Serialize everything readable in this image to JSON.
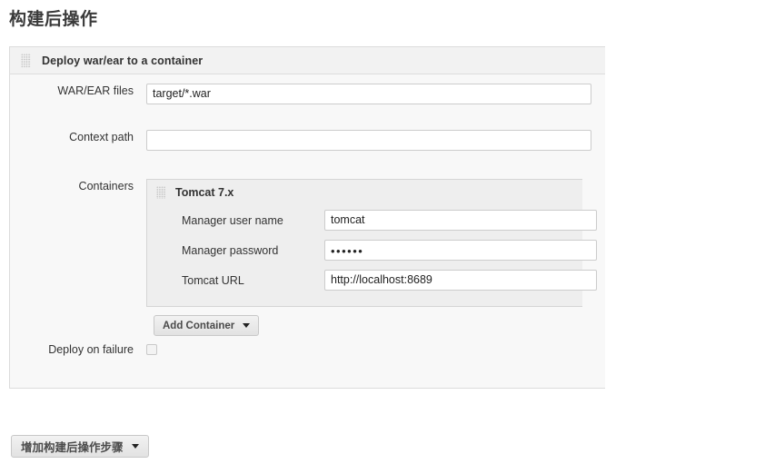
{
  "page": {
    "title": "构建后操作"
  },
  "post_build_block": {
    "title": "Deploy war/ear to a container",
    "grip_icon": "drag-grip-icon",
    "fields": {
      "war_ear_label": "WAR/EAR files",
      "war_ear_value": "target/*.war",
      "context_path_label": "Context path",
      "context_path_value": "",
      "containers_label": "Containers",
      "deploy_on_failure_label": "Deploy on failure",
      "deploy_on_failure_checked": false
    },
    "container": {
      "title": "Tomcat 7.x",
      "grip_icon": "drag-grip-icon",
      "rows": [
        {
          "label": "Manager user name",
          "value": "tomcat",
          "type": "text"
        },
        {
          "label": "Manager password",
          "value": "••••••",
          "type": "password"
        },
        {
          "label": "Tomcat URL",
          "value": "http://localhost:8689",
          "type": "text"
        }
      ]
    },
    "add_container_button": {
      "label": "Add Container",
      "caret_icon": "caret-down-icon"
    }
  },
  "bottom_button": {
    "label": "增加构建后操作步骤",
    "caret_icon": "caret-down-icon"
  }
}
